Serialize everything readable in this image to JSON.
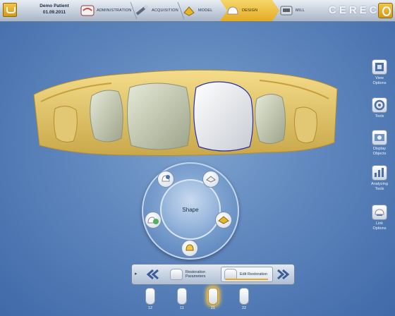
{
  "header": {
    "patient_name": "Demo Patient",
    "patient_date": "01.09.2011",
    "steps": [
      {
        "label": "ADMINISTRATION",
        "icon": "administration-icon"
      },
      {
        "label": "ACQUISITION",
        "icon": "acquisition-icon"
      },
      {
        "label": "MODEL",
        "icon": "model-icon"
      },
      {
        "label": "DESIGN",
        "icon": "design-icon",
        "active": true
      },
      {
        "label": "MILL",
        "icon": "mill-icon"
      }
    ],
    "brand": "CEREC"
  },
  "right_panel": [
    {
      "label_line1": "View",
      "label_line2": "Options",
      "icon": "view-options-icon"
    },
    {
      "label_line1": "Tools",
      "label_line2": "",
      "icon": "tools-icon"
    },
    {
      "label_line1": "Display",
      "label_line2": "Objects",
      "icon": "display-objects-icon"
    },
    {
      "label_line1": "Analyzing",
      "label_line2": "Tools",
      "icon": "analyzing-tools-icon"
    },
    {
      "label_line1": "Link",
      "label_line2": "Options",
      "icon": "link-options-icon"
    }
  ],
  "radial_menu": {
    "center_label": "Shape"
  },
  "bottom_nav": {
    "step1_line1": "Restoration",
    "step1_line2": "Parameters",
    "step2_label": "Edit Restoration"
  },
  "teeth": [
    {
      "number": "12",
      "active": false
    },
    {
      "number": "11",
      "active": false
    },
    {
      "number": "21",
      "active": true
    },
    {
      "number": "22",
      "active": false
    }
  ],
  "colors": {
    "accent": "#e5ab22",
    "background": "#5f86bd"
  }
}
